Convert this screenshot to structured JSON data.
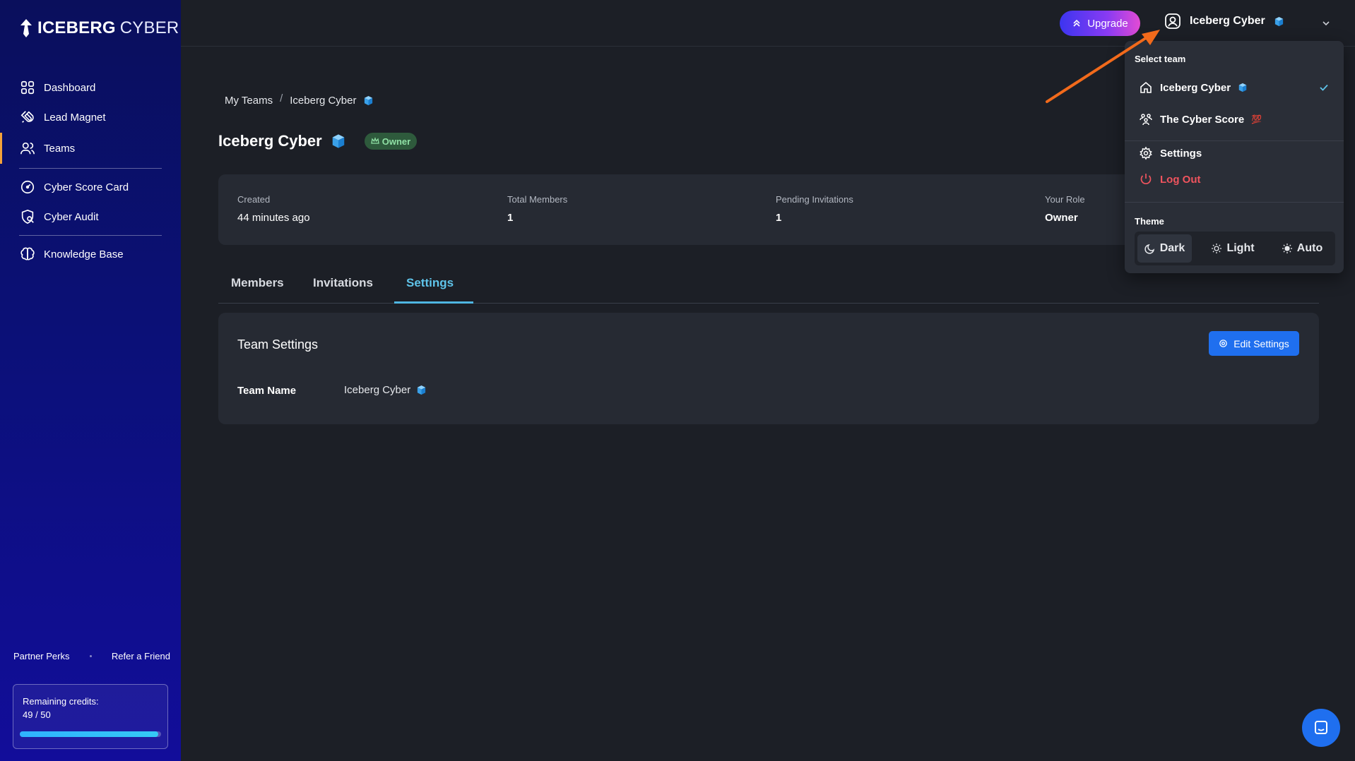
{
  "brand": {
    "name_bold": "ICEBERG",
    "name_thin": "CYBER"
  },
  "sidebar": {
    "items": [
      {
        "label": "Dashboard",
        "icon": "grid-icon"
      },
      {
        "label": "Lead Magnet",
        "icon": "magnet-icon"
      },
      {
        "label": "Teams",
        "icon": "users-icon",
        "active": true
      },
      {
        "label": "Cyber Score Card",
        "icon": "gauge-icon"
      },
      {
        "label": "Cyber Audit",
        "icon": "shield-search-icon"
      },
      {
        "label": "Knowledge Base",
        "icon": "brain-icon"
      }
    ],
    "bottom_links": {
      "partner": "Partner Perks",
      "refer": "Refer a Friend"
    },
    "credits": {
      "label": "Remaining credits:",
      "count": "49 / 50",
      "progress": 0.98
    }
  },
  "topbar": {
    "upgrade_label": "Upgrade",
    "account_name": "Iceberg Cyber"
  },
  "breadcrumb": {
    "root": "My Teams",
    "separator": "/",
    "current": "Iceberg Cyber"
  },
  "team": {
    "title": "Iceberg Cyber",
    "role_badge": "Owner"
  },
  "stats": {
    "created": {
      "label": "Created",
      "value": "44 minutes ago"
    },
    "members": {
      "label": "Total Members",
      "value": "1"
    },
    "pending": {
      "label": "Pending Invitations",
      "value": "1"
    },
    "role": {
      "label": "Your Role",
      "value": "Owner"
    }
  },
  "tabs": {
    "members": "Members",
    "invitations": "Invitations",
    "settings": "Settings",
    "active": "Settings"
  },
  "settings_card": {
    "title": "Team Settings",
    "edit_label": "Edit Settings",
    "team_name_label": "Team Name",
    "team_name_value": "Iceberg Cyber"
  },
  "dropdown": {
    "select_team_label": "Select team",
    "teams": [
      {
        "name": "Iceberg Cyber",
        "emoji": "cube",
        "selected": true
      },
      {
        "name": "The Cyber Score",
        "emoji": "💯",
        "selected": false
      }
    ],
    "settings_label": "Settings",
    "logout_label": "Log Out",
    "theme_label": "Theme",
    "theme_options": {
      "dark": "Dark",
      "light": "Light",
      "auto": "Auto"
    },
    "theme_selected": "Dark"
  },
  "colors": {
    "accent_blue": "#1f6fef",
    "tab_active": "#5fc4ea",
    "logout_red": "#f0545e",
    "annotation_arrow": "#f26a1b",
    "owner_badge_bg": "#2e5a3c"
  }
}
